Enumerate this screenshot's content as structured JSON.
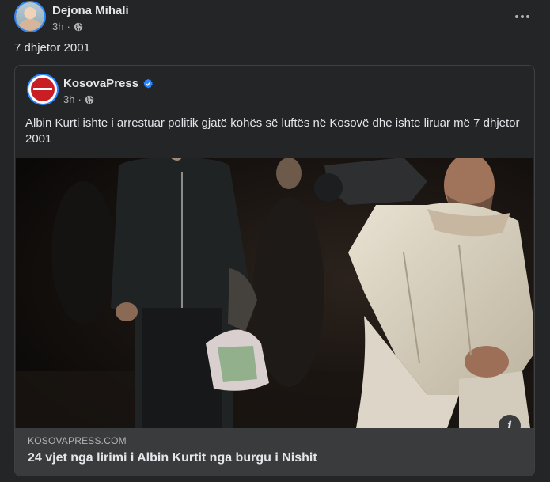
{
  "post": {
    "author": "Dejona Mihali",
    "time": "3h",
    "separator": "·",
    "privacy_icon": "globe-icon",
    "text": "7 dhjetor 2001"
  },
  "shared": {
    "page_name": "KosovaPress",
    "verified_icon": "verified-badge-icon",
    "time": "3h",
    "separator": "·",
    "privacy_icon": "globe-icon",
    "text": "Albin Kurti ishte i arrestuar politik gjatë kohës së luftës në Kosovë dhe ishte liruar më 7 dhjetor 2001",
    "link": {
      "domain": "KOSOVAPRESS.COM",
      "title": "24 vjet nga lirimi i Albin Kurtit nga burgu i Nishit"
    },
    "info_icon": "info-icon",
    "info_glyph": "i"
  },
  "colors": {
    "background": "#242526",
    "card_border": "#3e4042",
    "link_box": "#3a3b3c",
    "accent": "#2d88ff",
    "text_primary": "#e4e6eb",
    "text_secondary": "#b0b3b8"
  }
}
